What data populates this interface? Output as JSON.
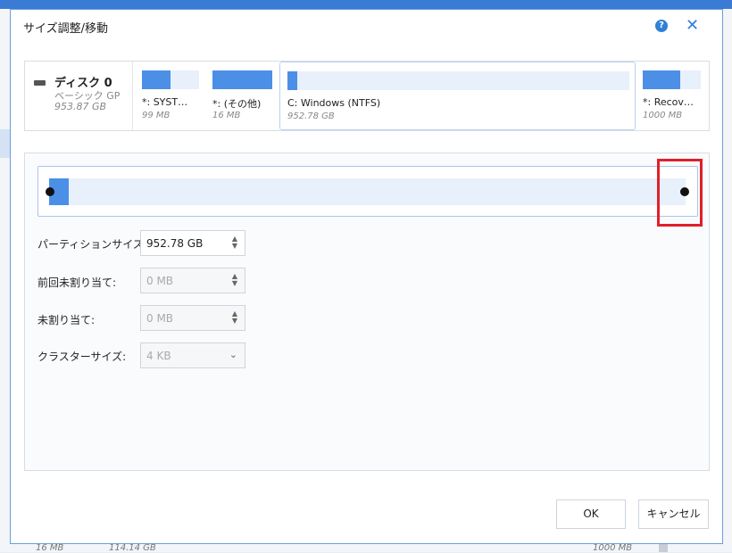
{
  "dialog": {
    "title": "サイズ調整/移動",
    "help_icon": "question-icon",
    "close_icon": "close-icon"
  },
  "disk": {
    "name": "ディスク 0",
    "type": "ベーシック GP",
    "size": "953.87 GB"
  },
  "partitions": [
    {
      "label": "*: SYST…",
      "size": "99 MB",
      "fill": 0.5
    },
    {
      "label": "*: (その他)",
      "size": "16 MB",
      "fill": 1.0
    },
    {
      "label": "C: Windows (NTFS)",
      "size": "952.78 GB",
      "fill": 0.03
    },
    {
      "label": "*: Recov…",
      "size": "1000 MB",
      "fill": 0.65
    }
  ],
  "fields": {
    "partition_size": {
      "label": "パーティションサイズ:",
      "value": "952.78 GB"
    },
    "unallocated_before": {
      "label": "前回未割り当て:",
      "value": "0 MB"
    },
    "unallocated_after": {
      "label": "未割り当て:",
      "value": "0 MB"
    },
    "cluster_size": {
      "label": "クラスターサイズ:",
      "value": "4 KB"
    }
  },
  "buttons": {
    "ok": "OK",
    "cancel": "キャンセル"
  },
  "background": {
    "bottom_size_1": "16 MB",
    "bottom_size_2": "114.14 GB",
    "bottom_size_3": "1000 MB"
  },
  "colors": {
    "accent": "#4c8fe6",
    "highlight": "#e0202a"
  }
}
